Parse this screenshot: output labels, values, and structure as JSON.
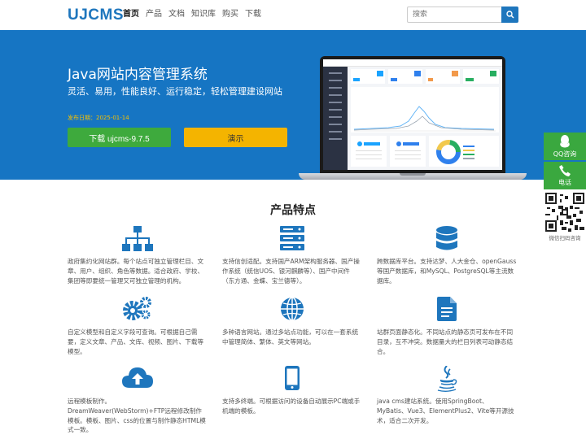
{
  "header": {
    "logo": "UJCMS",
    "nav": [
      "首页",
      "产品",
      "文档",
      "知识库",
      "购买",
      "下载"
    ],
    "search_placeholder": "搜索"
  },
  "hero": {
    "title": "Java网站内容管理系统",
    "subtitle": "灵活、易用，性能良好、运行稳定，轻松管理建设网站",
    "date": "发布日期：2025-01-14",
    "download_label": "下载 ujcms-9.7.5",
    "demo_label": "演示"
  },
  "features": {
    "title": "产品特点",
    "items": [
      {
        "icon": "sitemap-icon",
        "text": "政府集约化网站群。每个站点可独立管理栏目、文章、用户、组织、角色等数据。适合政府、学校、集团等即要统一管理又可独立管理的机构。"
      },
      {
        "icon": "server-icon",
        "text": "支持信创适配。支持国产ARM架构服务器、国产操作系统（统信UOS、银河麒麟等）、国产中间件（东方通、金蝶、宝兰德等）。"
      },
      {
        "icon": "database-icon",
        "text": "跨数据库平台。支持达梦、人大金仓、openGauss等国产数据库，和MySQL、PostgreSQL等主流数据库。"
      },
      {
        "icon": "gears-icon",
        "text": "自定义模型和自定义字段可查询。可根据自己需要，定义文章、产品、文库、视频、图片、下载等模型。"
      },
      {
        "icon": "globe-icon",
        "text": "多种语言网站。通过多站点功能，可以在一套系统中管理简体、繁体、英文等网站。"
      },
      {
        "icon": "document-icon",
        "text": "站群页面静态化。不同站点的静态页可发布在不同目录，互不冲突。数据量大的栏目列表可动静态结合。"
      },
      {
        "icon": "cloud-upload-icon",
        "text": "远程模板制作。DreamWeaver(WebStorm)+FTP远程修改制作模板。模板、图片、css的位置与制作静态HTML模式一致。"
      },
      {
        "icon": "mobile-icon",
        "text": "支持多终端。可根据访问的设备自动展示PC端或手机端的模板。"
      },
      {
        "icon": "java-icon",
        "text": "java cms建站系统。使用SpringBoot、MyBatis、Vue3、ElementPlus2、Vite等开源技术，适合二次开发。"
      }
    ]
  },
  "side": {
    "qq_label": "QQ咨询",
    "phone_label": "电话",
    "qr_label": "微信扫码咨询"
  },
  "colors": {
    "brand": "#1e76bd",
    "hero_bg": "#1675c3",
    "download": "#3eaa3d",
    "demo": "#f4b400",
    "side": "#3aa83f"
  }
}
